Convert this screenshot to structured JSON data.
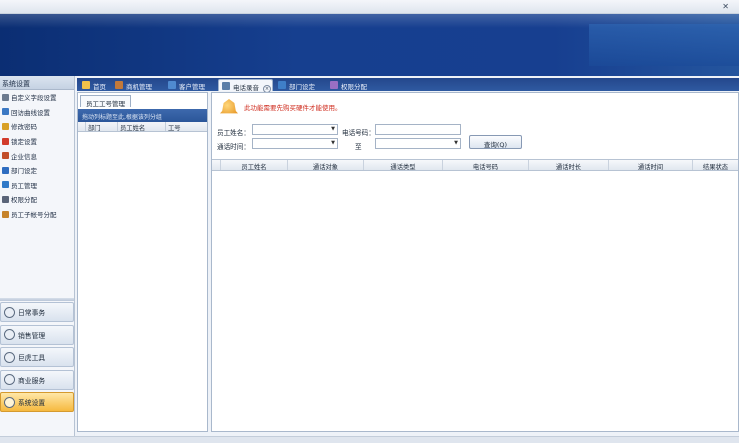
{
  "sidebar": {
    "header": "系统设置",
    "items": [
      {
        "label": "自定义字段设置",
        "icon": "gear-icon",
        "color": "#6d7b8f"
      },
      {
        "label": "回访曲线设置",
        "icon": "chart-icon",
        "color": "#3b78c3"
      },
      {
        "label": "修改密码",
        "icon": "key-icon",
        "color": "#d8a026"
      },
      {
        "label": "锁定设置",
        "icon": "lock-icon",
        "color": "#d23b2b"
      },
      {
        "label": "企业信息",
        "icon": "building-icon",
        "color": "#c24e2a"
      },
      {
        "label": "部门设定",
        "icon": "department-icon",
        "color": "#2d6cc0"
      },
      {
        "label": "员工管理",
        "icon": "user-icon",
        "color": "#2f79c8"
      },
      {
        "label": "权限分配",
        "icon": "permission-icon",
        "color": "#5a6478"
      },
      {
        "label": "员工子帐号分配",
        "icon": "subaccount-icon",
        "color": "#c6832b"
      }
    ],
    "nav": [
      {
        "label": "日常事务",
        "icon": "clock-icon"
      },
      {
        "label": "销售管理",
        "icon": "sales-icon"
      },
      {
        "label": "巨虎工具",
        "icon": "tools-icon"
      },
      {
        "label": "商业服务",
        "icon": "business-icon"
      },
      {
        "label": "系统设置",
        "icon": "settings-icon",
        "active": true
      }
    ]
  },
  "tabs": [
    {
      "label": "首页",
      "icon": "home-icon"
    },
    {
      "label": "商机管理",
      "icon": "opportunity-icon"
    },
    {
      "label": "客户管理",
      "icon": "customer-icon"
    },
    {
      "label": "电话录音",
      "icon": "phone-icon",
      "active": true
    },
    {
      "label": "部门设定",
      "icon": "department-icon"
    },
    {
      "label": "权限分配",
      "icon": "permission-icon"
    }
  ],
  "employee_panel": {
    "tab": "员工工号管理",
    "hint": "拖动列标题至此,根据该列分组",
    "columns": [
      "部门",
      "员工姓名",
      "工号"
    ]
  },
  "main": {
    "notice": "此功能需要先购买硬件才能使用。",
    "form": {
      "employee_label": "员工姓名：",
      "phone_label": "电话号码：",
      "time_label": "通话时间：",
      "to_label": "至",
      "query_button": "查询(Q)"
    },
    "columns": [
      "员工姓名",
      "通话对象",
      "通话类型",
      "电话号码",
      "通话时长",
      "通话时间",
      "结果状态"
    ]
  },
  "colors": {
    "banner": "#163f8f",
    "active_nav": "#f6b93f",
    "notice_text": "#cf2b1d"
  }
}
